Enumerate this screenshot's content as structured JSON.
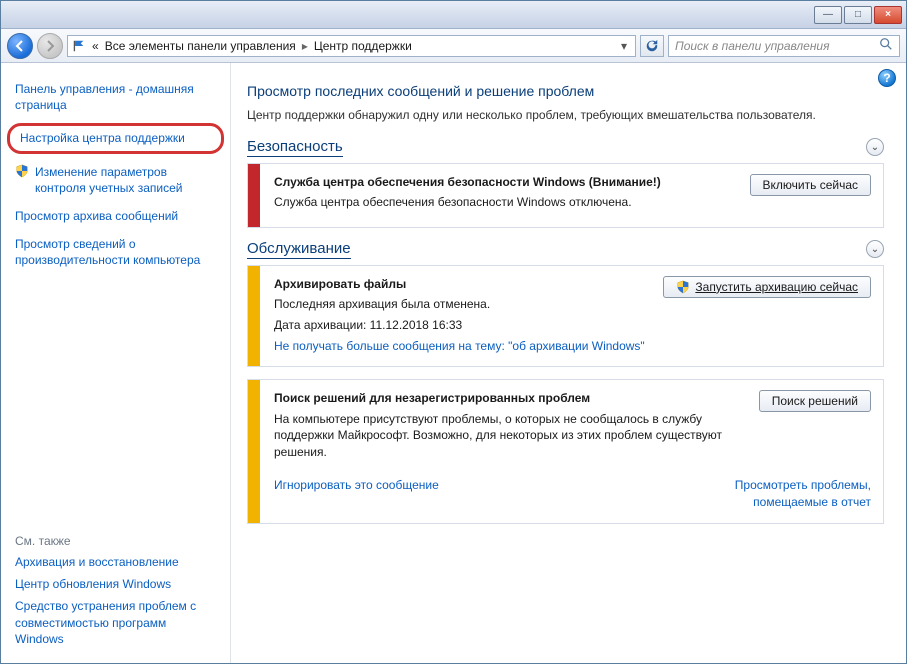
{
  "titlebar": {
    "min": "—",
    "max": "□",
    "close": "×"
  },
  "nav": {
    "crumb_prefix": "«",
    "crumb1": "Все элементы панели управления",
    "crumb2": "Центр поддержки",
    "search_placeholder": "Поиск в панели управления"
  },
  "sidebar": {
    "home": "Панель управления - домашняя страница",
    "configure": "Настройка центра поддержки",
    "uac": "Изменение параметров контроля учетных записей",
    "archive": "Просмотр архива сообщений",
    "perf": "Просмотр сведений о производительности компьютера",
    "see_also_h": "См. также",
    "backup": "Архивация и восстановление",
    "wupdate": "Центр обновления Windows",
    "compat": "Средство устранения проблем с совместимостью программ Windows"
  },
  "main": {
    "title": "Просмотр последних сообщений и решение проблем",
    "subtext": "Центр поддержки обнаружил одну или несколько проблем, требующих вмешательства пользователя.",
    "sec_h": "Безопасность",
    "maint_h": "Обслуживание"
  },
  "card1": {
    "title": "Служба центра обеспечения безопасности Windows (Внимание!)",
    "desc": "Служба центра обеспечения безопасности Windows отключена.",
    "btn": "Включить сейчас"
  },
  "card2": {
    "title": "Архивировать файлы",
    "desc": "Последняя архивация была отменена.",
    "date": "Дата архивации: 11.12.2018 16:33",
    "link": "Не получать больше сообщения на тему: \"об архивации Windows\"",
    "btn": "Запустить архивацию сейчас"
  },
  "card3": {
    "title": "Поиск решений для незарегистрированных проблем",
    "desc": "На компьютере присутствуют проблемы, о которых не сообщалось в службу поддержки Майкрософт. Возможно, для некоторых из этих проблем существуют решения.",
    "btn": "Поиск решений",
    "link_ignore": "Игнорировать это сообщение",
    "link_view": "Просмотреть проблемы, помещаемые в отчет"
  }
}
